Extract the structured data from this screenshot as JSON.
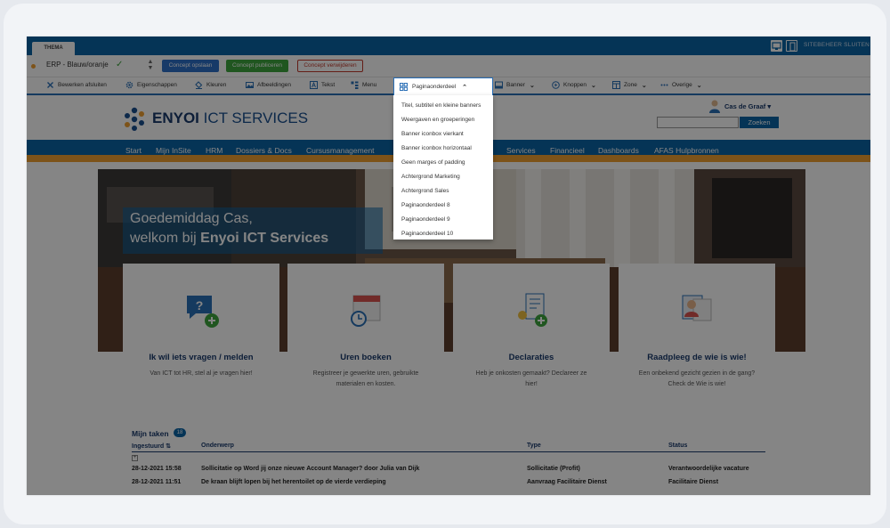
{
  "theme_bar": {
    "tab": "THEMA",
    "close": "SITEBEHEER SLUITEN"
  },
  "concept": {
    "theme": "ERP - Blauw/oranje",
    "save": "Concept opslaan",
    "publish": "Concept publiceren",
    "delete": "Concept verwijderen"
  },
  "toolbar": {
    "items": [
      "Bewerken afsluiten",
      "Eigenschappen",
      "Kleuren",
      "Afbeeldingen",
      "Tekst",
      "Menu",
      "Paginaonderdeel",
      "Banner",
      "Knoppen",
      "Zone",
      "Overige"
    ]
  },
  "dropdown": {
    "items": [
      "Titel, subtitel en kleine banners",
      "Weergaven en groeperingen",
      "Banner iconbox vierkant",
      "Banner iconbox horizontaal",
      "Geen marges of padding",
      "Achtergrond Marketing",
      "Achtergrond Sales",
      "Paginaonderdeel 8",
      "Paginaonderdeel 9",
      "Paginaonderdeel 10"
    ]
  },
  "header": {
    "logo_bold": "ENYOI",
    "logo_rest": " ICT SERVICES",
    "user": "Cas de Graaf",
    "search_button": "Zoeken"
  },
  "nav": {
    "items": [
      "Start",
      "Mijn InSite",
      "HRM",
      "Dossiers & Docs",
      "Cursusmanagement",
      "Services",
      "Financieel",
      "Dashboards",
      "AFAS Hulpbronnen"
    ]
  },
  "hero": {
    "line1": "Goedemiddag Cas,",
    "line2_pre": "welkom bij ",
    "line2_bold": "Enyoi ICT Services"
  },
  "cards": [
    {
      "title": "Ik wil iets vragen / melden",
      "desc": "Van ICT tot HR, stel al je vragen hier!"
    },
    {
      "title": "Uren boeken",
      "desc": "Registreer je gewerkte uren, gebruikte materialen en kosten."
    },
    {
      "title": "Declaraties",
      "desc": "Heb je onkosten gemaakt? Declareer ze hier!"
    },
    {
      "title": "Raadpleeg de wie is wie!",
      "desc": "Een onbekend gezicht gezien in de gang? Check de Wie is wie!"
    }
  ],
  "tasks": {
    "title": "Mijn taken",
    "count": "18",
    "headers": [
      "Ingestuurd",
      "Onderwerp",
      "Type",
      "Status"
    ],
    "rows": [
      [
        "28-12-2021 15:58",
        "Sollicitatie op Word jij onze nieuwe Account Manager? door Julia van Dijk",
        "Sollicitatie (Profit)",
        "Verantwoordelijke vacature"
      ],
      [
        "28-12-2021 11:51",
        "De kraan blijft lopen bij het herentoilet op de vierde verdieping",
        "Aanvraag Facilitaire Dienst",
        "Facilitaire Dienst"
      ]
    ]
  },
  "colors": {
    "brand_blue": "#0b64a6",
    "accent_orange": "#f0a030",
    "navy": "#1a3a6c"
  }
}
